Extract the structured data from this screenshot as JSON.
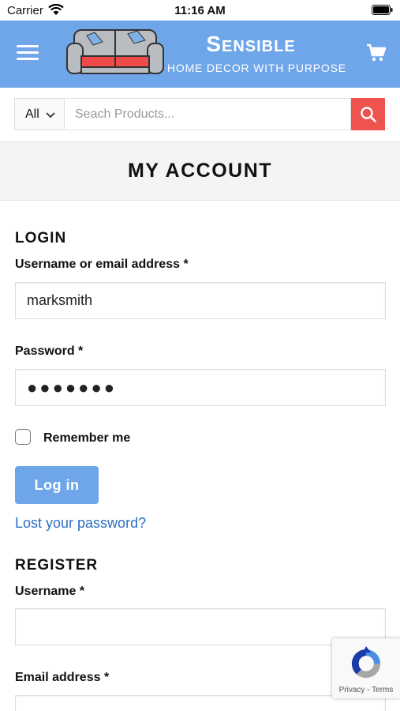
{
  "status_bar": {
    "carrier": "Carrier",
    "time": "11:16 AM"
  },
  "header": {
    "brand_name": "Sensible",
    "tagline": "HOME DECOR WITH PURPOSE",
    "accent_color": "#6fa6ea",
    "icons": {
      "menu": "hamburger-menu-icon",
      "cart": "cart-icon",
      "logo": "sofa-logo"
    }
  },
  "search": {
    "category_selected": "All",
    "placeholder": "Seach Products...",
    "value": "",
    "button_color": "#ef5350",
    "icon": "search-icon"
  },
  "page": {
    "title": "MY ACCOUNT"
  },
  "login": {
    "heading": "LOGIN",
    "username_label": "Username or email address *",
    "username_value": "marksmith",
    "password_label": "Password *",
    "password_value": "●●●●●●●",
    "remember_label": "Remember me",
    "remember_checked": false,
    "login_button": "Log in",
    "lost_password": "Lost your password?"
  },
  "register": {
    "heading": "REGISTER",
    "username_label": "Username *",
    "username_value": "",
    "email_label": "Email address *",
    "email_value": ""
  },
  "recaptcha": {
    "links": "Privacy - Terms",
    "icon": "recaptcha-icon"
  }
}
